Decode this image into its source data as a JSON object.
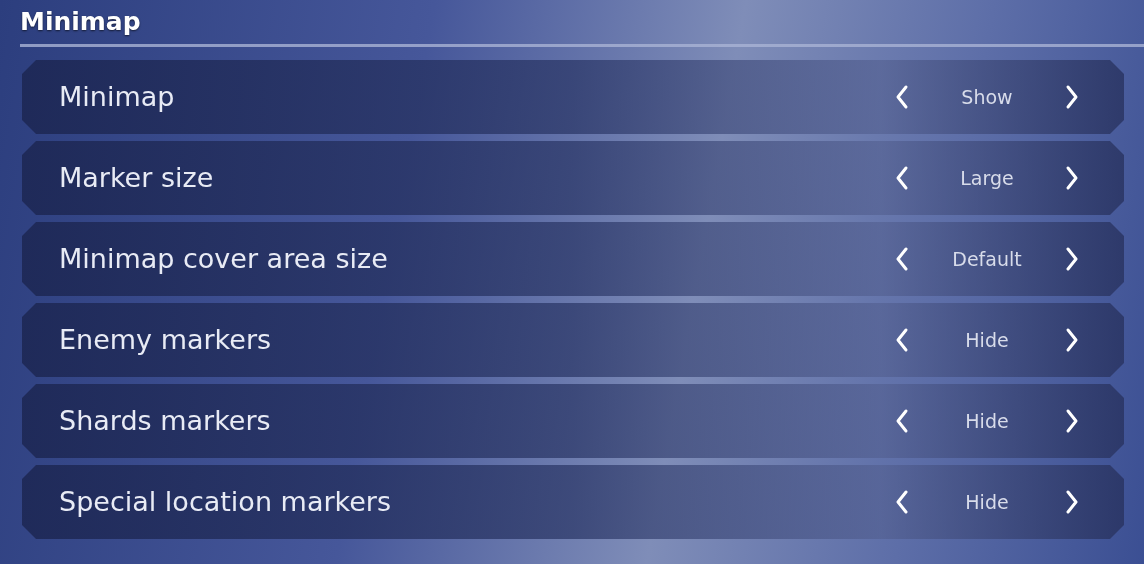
{
  "section": {
    "title": "Minimap"
  },
  "settings": [
    {
      "label": "Minimap",
      "value": "Show"
    },
    {
      "label": "Marker size",
      "value": "Large"
    },
    {
      "label": "Minimap cover area size",
      "value": "Default"
    },
    {
      "label": "Enemy markers",
      "value": "Hide"
    },
    {
      "label": "Shards markers",
      "value": "Hide"
    },
    {
      "label": "Special location markers",
      "value": "Hide"
    }
  ]
}
